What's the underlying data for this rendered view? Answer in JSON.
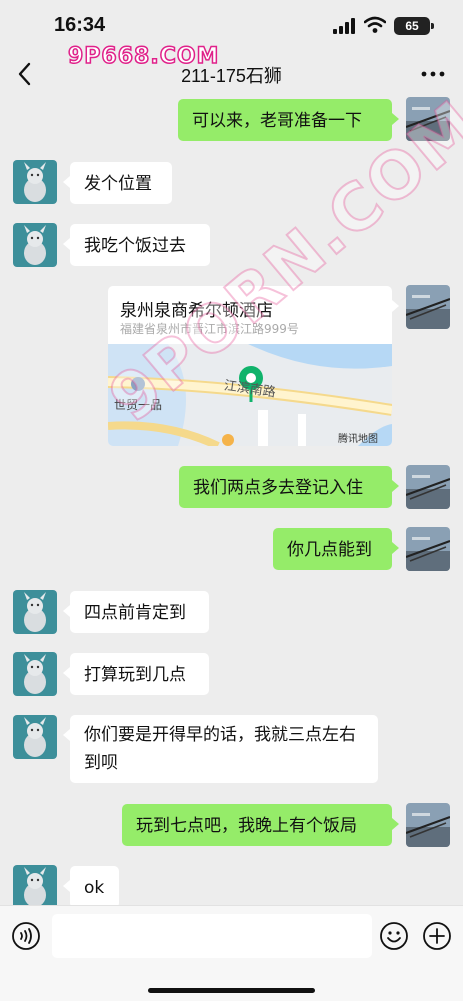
{
  "status": {
    "time": "16:34",
    "battery": "65"
  },
  "header": {
    "title": "211-175石狮",
    "watermark": "9P668.COM"
  },
  "overlay_watermark": "9PORN.COM",
  "messages": [
    {
      "from": "me",
      "text": "可以来，老哥准备一下"
    },
    {
      "from": "other",
      "text": "发个位置"
    },
    {
      "from": "other",
      "text": "我吃个饭过去"
    },
    {
      "from": "me",
      "type": "location",
      "name": "泉州泉商希尔顿酒店",
      "address": "福建省泉州市晋江市滨江路999号",
      "map_labels": {
        "road": "江滨南路",
        "poi": "世贸一品",
        "brand": "腾讯地图"
      }
    },
    {
      "from": "me",
      "text": "我们两点多去登记入住"
    },
    {
      "from": "me",
      "text": "你几点能到"
    },
    {
      "from": "other",
      "text": "四点前肯定到"
    },
    {
      "from": "other",
      "text": "打算玩到几点"
    },
    {
      "from": "other",
      "text": "你们要是开得早的话，我就三点左右到呗"
    },
    {
      "from": "me",
      "text": "玩到七点吧，我晚上有个饭局"
    },
    {
      "from": "other",
      "text": "ok"
    }
  ],
  "colors": {
    "outgoing_bubble": "#95ec69",
    "incoming_bubble": "#ffffff",
    "background": "#ededed",
    "map_pin": "#10b36b"
  },
  "icons": {
    "back": "chevron-left-icon",
    "more": "more-dots-icon",
    "voice": "voice-icon",
    "emoji": "emoji-icon",
    "plus": "plus-icon"
  }
}
